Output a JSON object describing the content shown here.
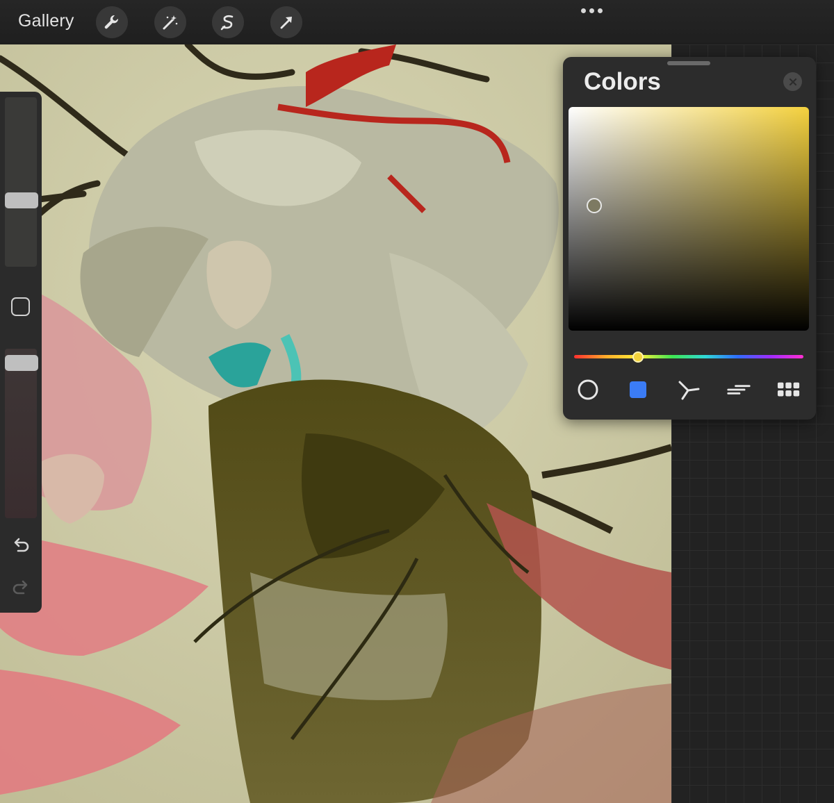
{
  "topbar": {
    "gallery_label": "Gallery",
    "tools": [
      {
        "icon": "wrench-icon",
        "name": "actions"
      },
      {
        "icon": "magic-wand-icon",
        "name": "adjustments"
      },
      {
        "icon": "selection-s-icon",
        "name": "selection"
      },
      {
        "icon": "arrow-cursor-icon",
        "name": "transform"
      }
    ],
    "more_icon": "ellipsis-icon"
  },
  "sidebar": {
    "brush_size_level": 0.38,
    "opacity_level": 0.04,
    "undo_icon": "undo-icon",
    "redo_icon": "redo-icon"
  },
  "colors_panel": {
    "title": "Colors",
    "close_icon": "close-icon",
    "selected_hue_color": "#f4d13e",
    "current_color": "#7d7a62",
    "hue_level": 0.28,
    "modes": [
      {
        "icon": "disc-icon",
        "name": "disc"
      },
      {
        "icon": "classic-square-icon",
        "name": "classic",
        "active": true
      },
      {
        "icon": "harmony-icon",
        "name": "harmony"
      },
      {
        "icon": "value-sliders-icon",
        "name": "value"
      },
      {
        "icon": "palettes-grid-icon",
        "name": "palettes"
      }
    ],
    "active_color": "#3b7cf5"
  }
}
